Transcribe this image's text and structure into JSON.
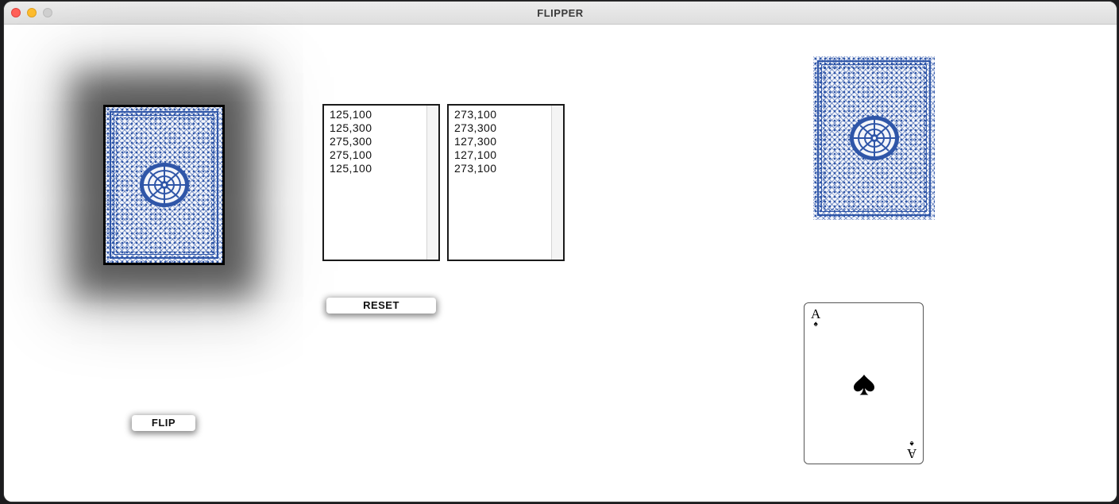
{
  "window": {
    "title": "FLIPPER"
  },
  "lists": {
    "left": [
      "125,100",
      "125,300",
      "275,300",
      "275,100",
      "125,100"
    ],
    "right": [
      "273,100",
      "273,300",
      "127,300",
      "127,100",
      "273,100"
    ]
  },
  "buttons": {
    "reset_label": "RESET",
    "flip_label": "FLIP"
  },
  "ace": {
    "rank": "A",
    "suit_icon": "spade-icon"
  },
  "colors": {
    "card_pattern": "#2f56a8",
    "close": "#ff5f57",
    "minimize": "#febc2e"
  }
}
